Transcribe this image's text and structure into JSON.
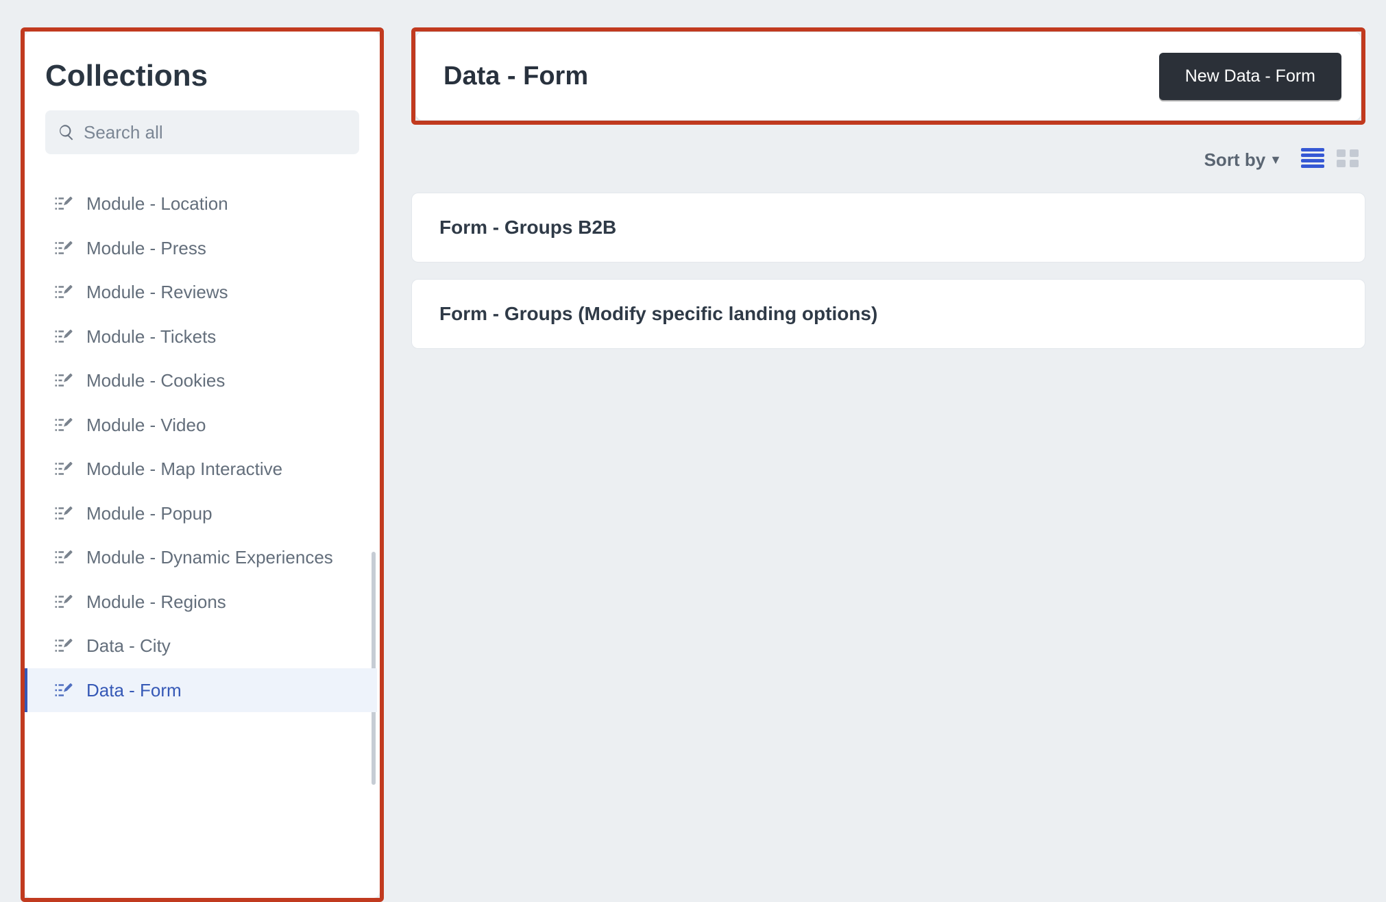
{
  "sidebar": {
    "title": "Collections",
    "search_placeholder": "Search all",
    "items": [
      {
        "label": "Module - Location",
        "active": false
      },
      {
        "label": "Module - Press",
        "active": false
      },
      {
        "label": "Module - Reviews",
        "active": false
      },
      {
        "label": "Module - Tickets",
        "active": false
      },
      {
        "label": "Module - Cookies",
        "active": false
      },
      {
        "label": "Module - Video",
        "active": false
      },
      {
        "label": "Module - Map Interactive",
        "active": false
      },
      {
        "label": "Module - Popup",
        "active": false
      },
      {
        "label": "Module - Dynamic Experiences",
        "active": false
      },
      {
        "label": "Module - Regions",
        "active": false
      },
      {
        "label": "Data - City",
        "active": false
      },
      {
        "label": "Data - Form",
        "active": true
      }
    ]
  },
  "header": {
    "title": "Data - Form",
    "new_button_label": "New Data - Form"
  },
  "toolbar": {
    "sort_by_label": "Sort by",
    "view_mode": "list"
  },
  "entries": [
    {
      "title": "Form - Groups B2B"
    },
    {
      "title": "Form - Groups (Modify specific landing options)"
    }
  ],
  "highlight_boxes": [
    "sidebar",
    "header"
  ]
}
